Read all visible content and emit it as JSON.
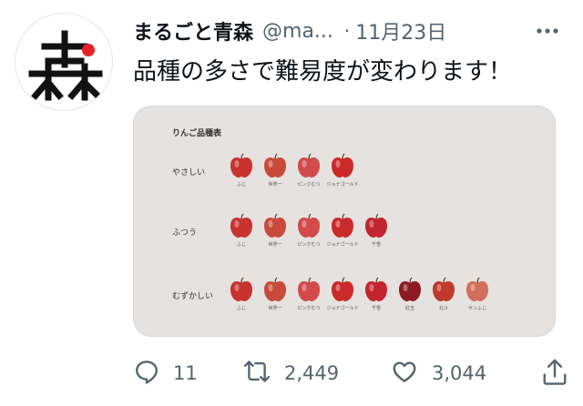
{
  "tweet": {
    "display_name": "まるごと青森",
    "handle": "@ma...",
    "dot": "·",
    "date": "11月23日",
    "text": "品種の多さで難易度が変わります！"
  },
  "avatar": {
    "logo_text": "森",
    "accent_color": "#e8202a"
  },
  "image_card": {
    "title": "りんご品種表",
    "rows": [
      {
        "label": "やさしい",
        "apples": [
          {
            "name": "ふじ",
            "color": "#c8322f"
          },
          {
            "name": "世界一",
            "color": "#c94a3a"
          },
          {
            "name": "ピンクむつ",
            "color": "#d24a4a"
          },
          {
            "name": "ジョナゴールド",
            "color": "#cc2a2a"
          }
        ]
      },
      {
        "label": "ふつう",
        "apples": [
          {
            "name": "ふじ",
            "color": "#c8322f"
          },
          {
            "name": "世界一",
            "color": "#c94a3a"
          },
          {
            "name": "ピンクむつ",
            "color": "#d24a4a"
          },
          {
            "name": "ジョナゴールド",
            "color": "#cc2a2a"
          },
          {
            "name": "千雪",
            "color": "#c32530"
          }
        ]
      },
      {
        "label": "むずかしい",
        "apples": [
          {
            "name": "ふじ",
            "color": "#c8322f"
          },
          {
            "name": "世界一",
            "color": "#c94a3a"
          },
          {
            "name": "ピンクむつ",
            "color": "#d24a4a"
          },
          {
            "name": "ジョナゴールド",
            "color": "#cc2a2a"
          },
          {
            "name": "千雪",
            "color": "#c32530"
          },
          {
            "name": "紅玉",
            "color": "#8e1a22"
          },
          {
            "name": "北斗",
            "color": "#c0392b"
          },
          {
            "name": "サンふじ",
            "color": "#d0705a"
          }
        ]
      }
    ]
  },
  "actions": {
    "reply_count": "11",
    "retweet_count": "2,449",
    "like_count": "3,044"
  },
  "colors": {
    "text_primary": "#0f1419",
    "text_secondary": "#536471",
    "card_bg": "#e6e2e0"
  },
  "icons": [
    "reply-icon",
    "retweet-icon",
    "like-icon",
    "share-icon",
    "more-icon"
  ]
}
